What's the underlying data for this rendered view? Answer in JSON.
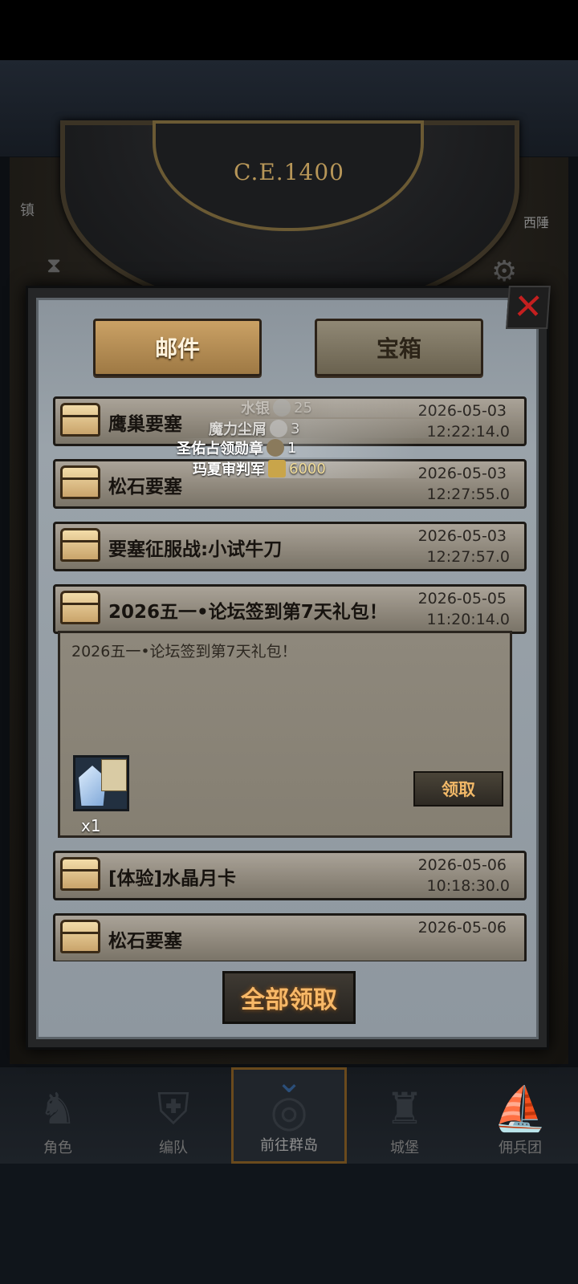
{
  "map": {
    "era": "C.E.1400",
    "left_label": "镇",
    "right_label": "西陲"
  },
  "tabs": [
    {
      "label": "邮件",
      "active": true
    },
    {
      "label": "宝箱",
      "active": false
    }
  ],
  "close_label": "✕",
  "mails": [
    {
      "title": "鹰巢要塞",
      "date": "2026-05-03",
      "time": "12:22:14.0"
    },
    {
      "title": "松石要塞",
      "date": "2026-05-03",
      "time": "12:27:55.0"
    },
    {
      "title": "要塞征服战:小试牛刀",
      "date": "2026-05-03",
      "time": "12:27:57.0"
    },
    {
      "title": "2026五一•论坛签到第7天礼包！",
      "date": "2026-05-05",
      "time": "11:20:14.0"
    },
    {
      "title": "[体验]水晶月卡",
      "date": "2026-05-06",
      "time": "10:18:30.0"
    },
    {
      "title": "松石要塞",
      "date": "2026-05-06",
      "time": ""
    }
  ],
  "expanded": {
    "body": "2026五一•论坛签到第7天礼包！",
    "reward_qty": "x1",
    "claim_label": "领取"
  },
  "overlay": [
    {
      "label": "水银",
      "value": "25"
    },
    {
      "label": "魔力尘屑",
      "value": "3"
    },
    {
      "label": "圣佑占领勋章",
      "value": "1"
    },
    {
      "label": "玛夏审判军",
      "value": "6000"
    }
  ],
  "claim_all_label": "全部领取",
  "nav": [
    {
      "label": "角色",
      "active": false
    },
    {
      "label": "编队",
      "active": false
    },
    {
      "label": "前往群岛",
      "active": true
    },
    {
      "label": "城堡",
      "active": false
    },
    {
      "label": "佣兵团",
      "active": false
    }
  ],
  "colors": {
    "accent_gold": "#caa165",
    "claim_text": "#f7b867",
    "close_red": "#c41f1f"
  }
}
